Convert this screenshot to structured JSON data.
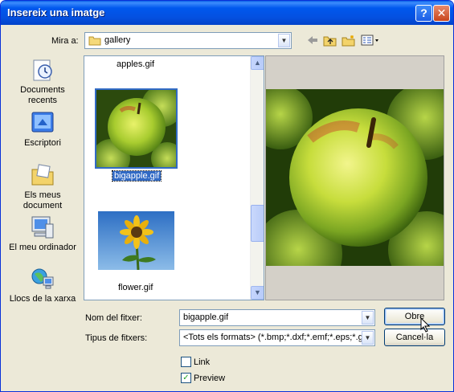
{
  "window": {
    "title": "Insereix una imatge",
    "help_glyph": "?",
    "close_glyph": "✕"
  },
  "lookin": {
    "label": "Mira a:",
    "value": "gallery"
  },
  "toolbar": {
    "back_icon": "back-arrow-icon",
    "up_icon": "up-folder-icon",
    "newfolder_icon": "new-folder-icon",
    "views_icon": "views-menu-icon"
  },
  "places": [
    {
      "label": "Documents recents",
      "icon": "recent-documents-icon"
    },
    {
      "label": "Escriptori",
      "icon": "desktop-icon"
    },
    {
      "label": "Els meus document",
      "icon": "my-documents-icon"
    },
    {
      "label": "El meu ordinador",
      "icon": "my-computer-icon"
    },
    {
      "label": "Llocs de la xarxa",
      "icon": "network-places-icon"
    }
  ],
  "files": [
    {
      "name": "apples.gif",
      "selected": false
    },
    {
      "name": "bigapple.gif",
      "selected": true
    },
    {
      "name": "flower.gif",
      "selected": false
    }
  ],
  "filename": {
    "label": "Nom del fitxer:",
    "value": "bigapple.gif"
  },
  "filetype": {
    "label": "Tipus de fitxers:",
    "value": "<Tots els formats> (*.bmp;*.dxf;*.emf;*.eps;*.gif;*"
  },
  "buttons": {
    "open": "Obre",
    "cancel": "Cancel·la"
  },
  "options": {
    "link_label": "Link",
    "link_checked": false,
    "preview_label": "Preview",
    "preview_checked": true
  },
  "colors": {
    "title_blue": "#0058ee",
    "selection_blue": "#316ac5",
    "dialog_bg": "#ece9d8"
  }
}
